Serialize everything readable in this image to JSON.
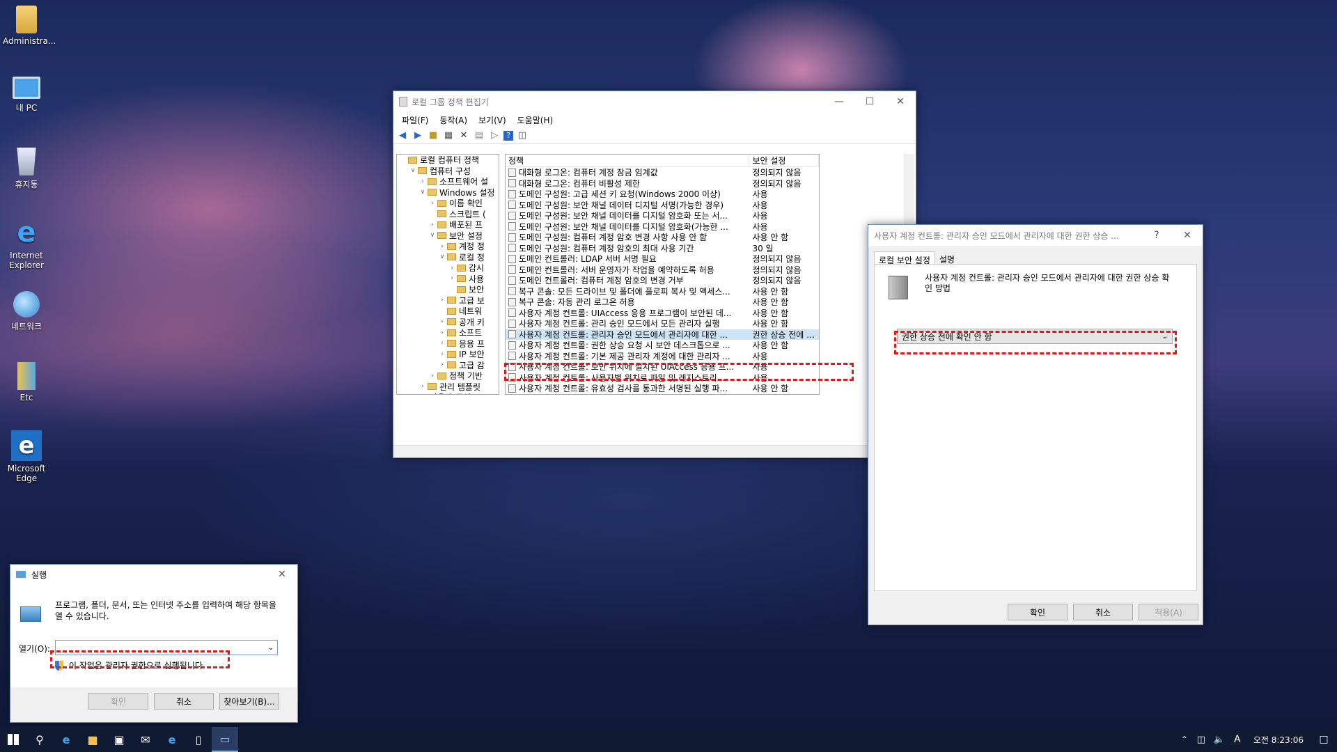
{
  "desktop": {
    "icons": [
      {
        "label": "Administra...",
        "icon": "user-folder-icon"
      },
      {
        "label": "내 PC",
        "icon": "computer-icon"
      },
      {
        "label": "휴지통",
        "icon": "recycle-bin-icon"
      },
      {
        "label": "Internet Explorer",
        "icon": "internet-explorer-icon"
      },
      {
        "label": "네트워크",
        "icon": "network-icon"
      },
      {
        "label": "Etc",
        "icon": "folder-icon"
      },
      {
        "label": "Microsoft Edge",
        "icon": "edge-icon"
      }
    ]
  },
  "gpedit": {
    "title": "로컬 그룹 정책 편집기",
    "menu": [
      "파일(F)",
      "동작(A)",
      "보기(V)",
      "도움말(H)"
    ],
    "tree": [
      {
        "label": "로컬 컴퓨터 정책",
        "indent": 0,
        "arrow": ""
      },
      {
        "label": "컴퓨터 구성",
        "indent": 1,
        "arrow": "v"
      },
      {
        "label": "소프트웨어 설",
        "indent": 2,
        "arrow": ">"
      },
      {
        "label": "Windows 설정",
        "indent": 2,
        "arrow": "v"
      },
      {
        "label": "이름 확인",
        "indent": 3,
        "arrow": ">"
      },
      {
        "label": "스크립트 (",
        "indent": 3,
        "arrow": ""
      },
      {
        "label": "배포된 프",
        "indent": 3,
        "arrow": ">"
      },
      {
        "label": "보안 설정",
        "indent": 3,
        "arrow": "v"
      },
      {
        "label": "계정 정",
        "indent": 4,
        "arrow": ">"
      },
      {
        "label": "로컬 정",
        "indent": 4,
        "arrow": "v"
      },
      {
        "label": "감시",
        "indent": 5,
        "arrow": ">"
      },
      {
        "label": "사용",
        "indent": 5,
        "arrow": ">"
      },
      {
        "label": "보안",
        "indent": 5,
        "arrow": ""
      },
      {
        "label": "고급 보",
        "indent": 4,
        "arrow": ">"
      },
      {
        "label": "네트워",
        "indent": 4,
        "arrow": ""
      },
      {
        "label": "공개 키",
        "indent": 4,
        "arrow": ">"
      },
      {
        "label": "소프트",
        "indent": 4,
        "arrow": ">"
      },
      {
        "label": "응용 프",
        "indent": 4,
        "arrow": ">"
      },
      {
        "label": "IP 보안",
        "indent": 4,
        "arrow": ">"
      },
      {
        "label": "고급 감",
        "indent": 4,
        "arrow": ">"
      },
      {
        "label": "정책 기반",
        "indent": 3,
        "arrow": ">"
      },
      {
        "label": "관리 템플릿",
        "indent": 2,
        "arrow": ">"
      },
      {
        "label": "사용자 구성",
        "indent": 1,
        "arrow": ">"
      }
    ],
    "columns": {
      "policy": "정책",
      "setting": "보안 설정"
    },
    "rows": [
      {
        "policy": "대화형 로그온: 컴퓨터 계정 잠금 임계값",
        "setting": "정의되지 않음"
      },
      {
        "policy": "대화형 로그온: 컴퓨터 비활성 제한",
        "setting": "정의되지 않음"
      },
      {
        "policy": "도메인 구성원: 고급 세션 키 요청(Windows 2000 이상)",
        "setting": "사용"
      },
      {
        "policy": "도메인 구성원: 보안 채널 데이터 디지털 서명(가능한 경우)",
        "setting": "사용"
      },
      {
        "policy": "도메인 구성원: 보안 채널 데이터를 디지털 암호화 또는 서...",
        "setting": "사용"
      },
      {
        "policy": "도메인 구성원: 보안 채널 데이터를 디지털 암호화(가능한 ...",
        "setting": "사용"
      },
      {
        "policy": "도메인 구성원: 컴퓨터 계정 암호 변경 사항 사용 안 함",
        "setting": "사용 안 함"
      },
      {
        "policy": "도메인 구성원: 컴퓨터 계정 암호의 최대 사용 기간",
        "setting": "30 일"
      },
      {
        "policy": "도메인 컨트롤러: LDAP 서버 서명 필요",
        "setting": "정의되지 않음"
      },
      {
        "policy": "도메인 컨트롤러: 서버 운영자가 작업을 예약하도록 허용",
        "setting": "정의되지 않음"
      },
      {
        "policy": "도메인 컨트롤러: 컴퓨터 계정 암호의 변경 거부",
        "setting": "정의되지 않음"
      },
      {
        "policy": "복구 콘솔: 모든 드라이브 및 폴더에 플로피 복사 및 액세스...",
        "setting": "사용 안 함"
      },
      {
        "policy": "복구 콘솔: 자동 관리 로그온 허용",
        "setting": "사용 안 함"
      },
      {
        "policy": "사용자 계정 컨트롤: UIAccess 응용 프로그램이 보안된 데...",
        "setting": "사용 안 함"
      },
      {
        "policy": "사용자 계정 컨트롤: 관리 승인 모드에서 모든 관리자 실행",
        "setting": "사용 안 함"
      },
      {
        "policy": "사용자 계정 컨트롤: 관리자 승인 모드에서 관리자에 대한 ...",
        "setting": "권한 상승 전에 확인 안 ...",
        "selected": true
      },
      {
        "policy": "사용자 계정 컨트롤: 권한 상승 요청 시 보안 데스크톱으로 ...",
        "setting": "사용 안 함"
      },
      {
        "policy": "사용자 계정 컨트롤: 기본 제공 관리자 계정에 대한 관리자 ...",
        "setting": "사용"
      },
      {
        "policy": "사용자 계정 컨트롤: 보안 위치에 설치된 UIAccess 응용 프...",
        "setting": "사용"
      },
      {
        "policy": "사용자 계정 컨트롤: 사용자별 위치로 파일 및 레지스트리 ...",
        "setting": "사용"
      },
      {
        "policy": "사용자 계정 컨트롤: 유효성 검사를 통과한 서명된 실행 파...",
        "setting": "사용 안 함"
      }
    ]
  },
  "props": {
    "title": "사용자 계정 컨트롤: 관리자 승인 모드에서 관리자에 대한 권한 상승 ...",
    "help": "?",
    "tabs": [
      "로컬 보안 설정",
      "설명"
    ],
    "description": "사용자 계정 컨트롤: 관리자 승인 모드에서 관리자에 대한 권한 상승 확인 방법",
    "dropdown_value": "권한 상승 전에 확인 안 함",
    "ok": "확인",
    "cancel": "취소",
    "apply": "적용(A)"
  },
  "run": {
    "title": "실행",
    "description": "프로그램, 폴더, 문서, 또는 인터넷 주소를 입력하여 해당 항목을 열 수 있습니다.",
    "open_label": "열기(O):",
    "input_value": "",
    "admin_note": "이 작업은 관리자 권한으로 실행됩니다.",
    "ok": "확인",
    "cancel": "취소",
    "browse": "찾아보기(B)..."
  },
  "taskbar": {
    "clock": "오전 8:23:06",
    "ime": "A"
  }
}
